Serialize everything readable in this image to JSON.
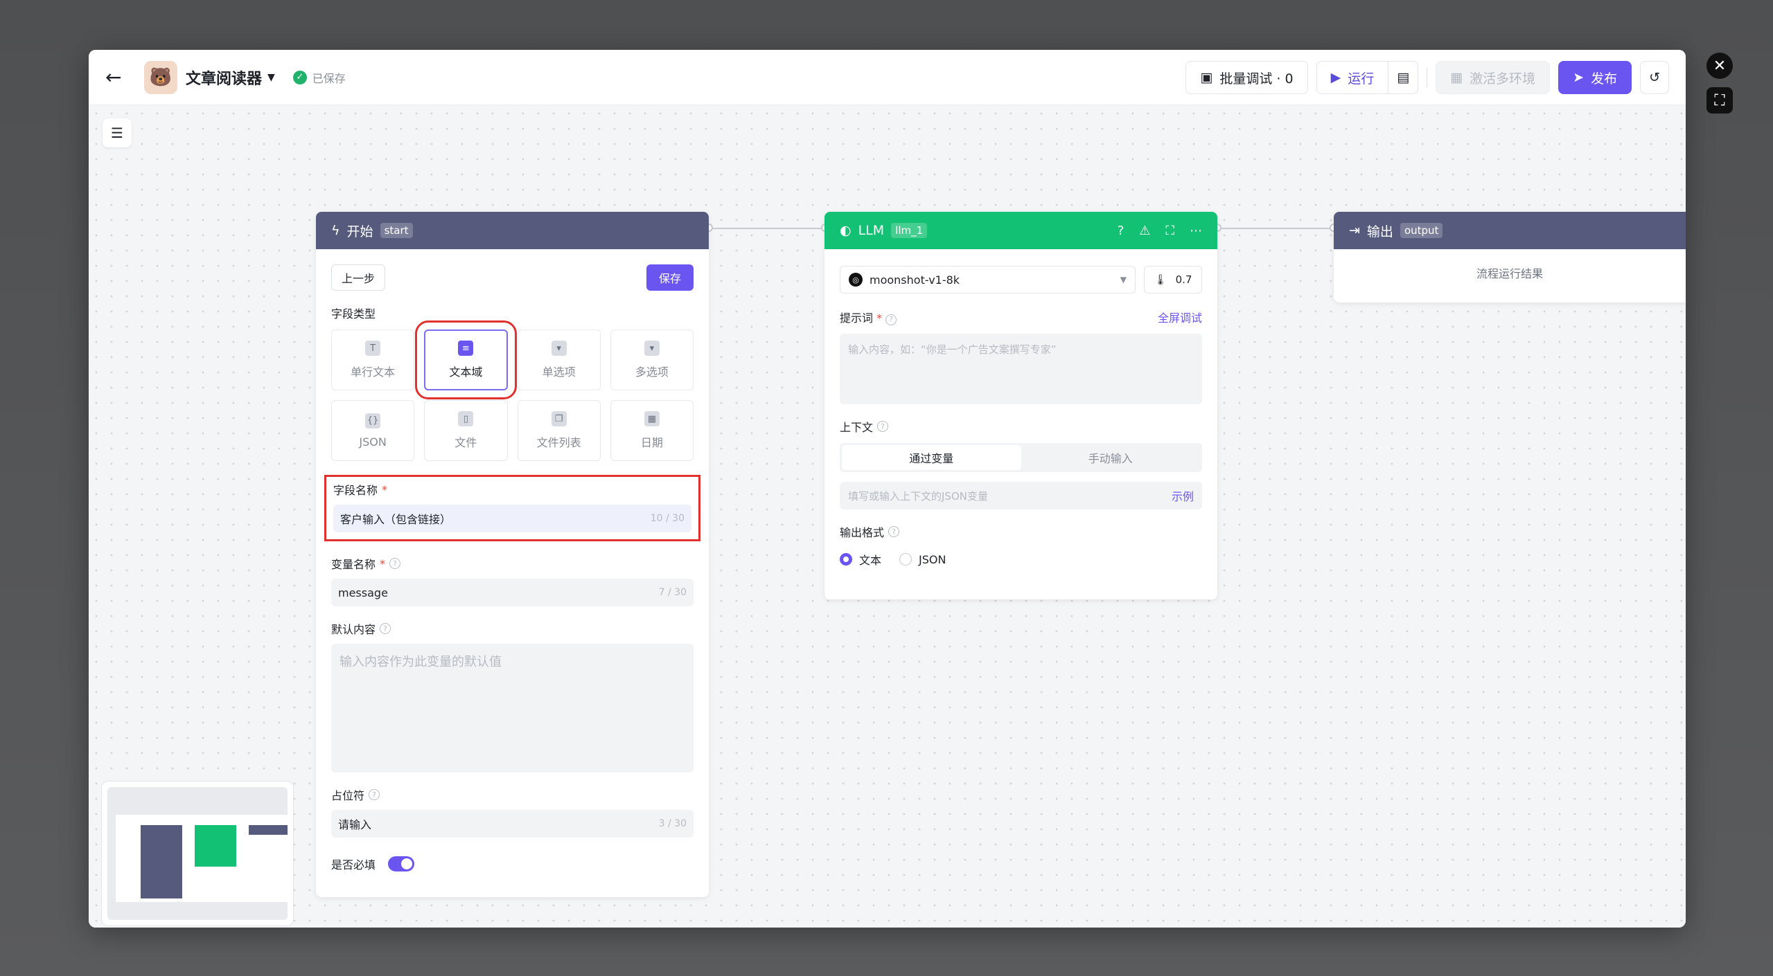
{
  "header": {
    "app_title": "文章阅读器",
    "saved_label": "已保存",
    "batch_label": "批量调试 · 0",
    "run_label": "运行",
    "env_label": "激活多环境",
    "publish_label": "发布"
  },
  "start_node": {
    "title": "开始",
    "tag": "start",
    "prev_label": "上一步",
    "save_label": "保存",
    "field_type_label": "字段类型",
    "types": [
      "单行文本",
      "文本域",
      "单选项",
      "多选项",
      "JSON",
      "文件",
      "文件列表",
      "日期"
    ],
    "field_name_label": "字段名称",
    "field_name_value": "客户输入（包含链接）",
    "field_name_count": "10 / 30",
    "var_name_label": "变量名称",
    "var_name_value": "message",
    "var_name_count": "7 / 30",
    "default_label": "默认内容",
    "default_placeholder": "输入内容作为此变量的默认值",
    "placeholder_label": "占位符",
    "placeholder_value": "请输入",
    "placeholder_count": "3 / 30",
    "required_label": "是否必填"
  },
  "llm_node": {
    "title": "LLM",
    "tag": "llm_1",
    "model": "moonshot-v1-8k",
    "temperature": "0.7",
    "prompt_label": "提示词",
    "fullscreen_label": "全屏调试",
    "prompt_placeholder": "输入内容，如：“你是一个广告文案撰写专家”",
    "context_label": "上下文",
    "seg_var": "通过变量",
    "seg_manual": "手动输入",
    "context_placeholder": "填写或输入上下文的JSON变量",
    "example_label": "示例",
    "output_format_label": "输出格式",
    "opt_text": "文本",
    "opt_json": "JSON"
  },
  "output_node": {
    "title": "输出",
    "tag": "output",
    "result_label": "流程运行结果"
  }
}
